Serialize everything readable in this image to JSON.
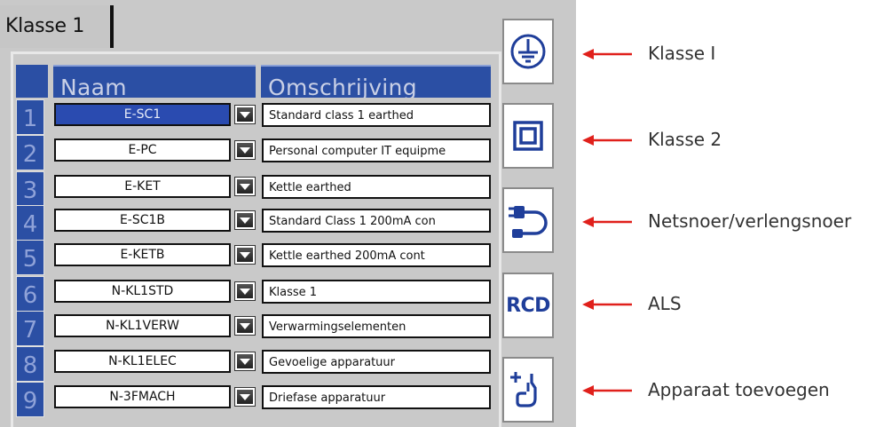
{
  "tab": {
    "label": "Klasse 1"
  },
  "table": {
    "headers": {
      "name": "Naam",
      "description": "Omschrijving"
    },
    "rows": [
      {
        "index": "1",
        "name": "E-SC1",
        "description": "Standard class 1 earthed",
        "selected": true
      },
      {
        "index": "2",
        "name": "E-PC",
        "description": "Personal computer IT equipme"
      },
      {
        "index": "3",
        "name": "E-KET",
        "description": "Kettle earthed"
      },
      {
        "index": "4",
        "name": "E-SC1B",
        "description": "Standard Class 1 200mA con"
      },
      {
        "index": "5",
        "name": "E-KETB",
        "description": "Kettle earthed 200mA cont"
      },
      {
        "index": "6",
        "name": "N-KL1STD",
        "description": "Klasse 1"
      },
      {
        "index": "7",
        "name": "N-KL1VERW",
        "description": "Verwarmingselementen"
      },
      {
        "index": "8",
        "name": "N-KL1ELEC",
        "description": "Gevoelige apparatuur"
      },
      {
        "index": "9",
        "name": "N-3FMACH",
        "description": "Driefase apparatuur"
      }
    ]
  },
  "side_buttons": [
    {
      "icon": "earth-ground-icon"
    },
    {
      "icon": "double-square-icon"
    },
    {
      "icon": "extension-lead-icon"
    },
    {
      "icon": "rcd-icon",
      "text": "RCD"
    },
    {
      "icon": "add-appliance-icon"
    }
  ],
  "callouts": [
    "Klasse I",
    "Klasse 2",
    "Netsnoer/verlengsnoer",
    "ALS",
    "Apparaat toevoegen"
  ],
  "colors": {
    "header_blue": "#2b4fa4",
    "arrow_red": "#e0201b",
    "icon_blue": "#1f3e9a"
  }
}
